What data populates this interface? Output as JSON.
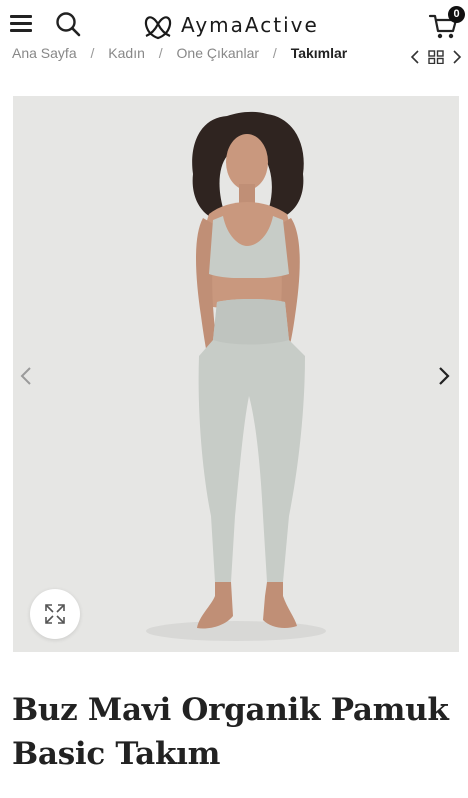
{
  "header": {
    "brand_name": "AymaActive",
    "menu_icon": "hamburger-menu-icon",
    "search_icon": "search-icon",
    "cart_icon": "shopping-cart-icon",
    "cart_count": "0"
  },
  "breadcrumb": {
    "items": [
      "Ana Sayfa",
      "Kadın",
      "Öne Çıkanlar",
      "Takımlar"
    ],
    "separator": "/",
    "controls": [
      "chevron-left-icon",
      "grid-icon",
      "chevron-right-icon"
    ]
  },
  "gallery": {
    "image_description": "model wearing pale sage/ice-blue sports bra and leggings",
    "prev_icon": "chevron-left-icon",
    "next_icon": "chevron-right-icon",
    "zoom_icon": "expand-icon"
  },
  "product": {
    "title_line1": "Buz Mavi Organik Pamuk",
    "title_line2": "Basic Takım"
  },
  "colors": {
    "text": "#222222",
    "image_bg": "#e6e6e4",
    "garment": "#c7ccc7"
  }
}
